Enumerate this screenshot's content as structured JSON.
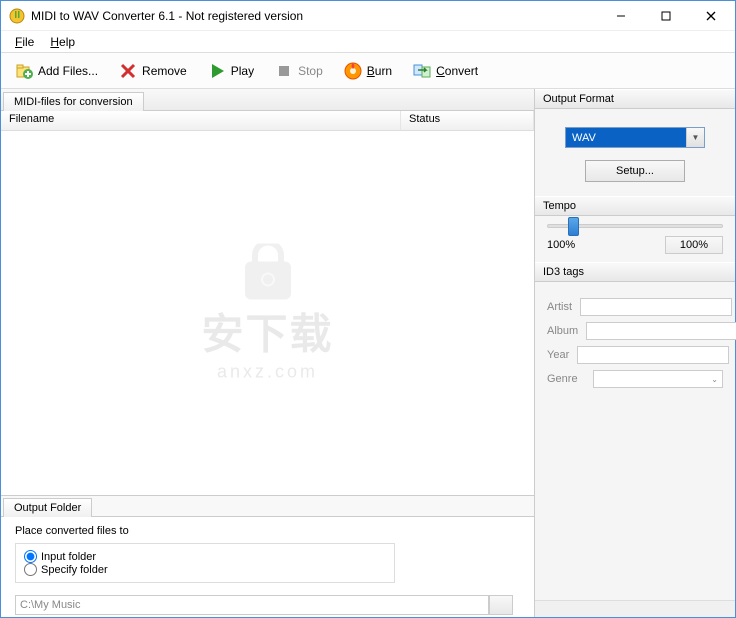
{
  "window": {
    "title": "MIDI to WAV Converter 6.1 - Not registered version"
  },
  "menu": {
    "file": "File",
    "help": "Help"
  },
  "toolbar": {
    "add_files": "Add Files...",
    "remove": "Remove",
    "play": "Play",
    "stop": "Stop",
    "burn": "Burn",
    "convert": "Convert"
  },
  "list_panel": {
    "tab": "MIDI-files for conversion",
    "col_filename": "Filename",
    "col_status": "Status"
  },
  "output_folder": {
    "tab": "Output Folder",
    "label": "Place converted files to",
    "opt_input": "Input folder",
    "opt_specify": "Specify folder",
    "path": "C:\\My Music"
  },
  "right": {
    "format_title": "Output Format",
    "format_value": "WAV",
    "setup": "Setup...",
    "tempo_title": "Tempo",
    "tempo_left": "100%",
    "tempo_value": "100%",
    "id3_title": "ID3 tags",
    "id3": {
      "artist_label": "Artist",
      "album_label": "Album",
      "year_label": "Year",
      "genre_label": "Genre",
      "artist": "",
      "album": "",
      "year": "",
      "genre": ""
    }
  },
  "watermark": {
    "zh": "安下载",
    "dom": "anxz.com"
  }
}
